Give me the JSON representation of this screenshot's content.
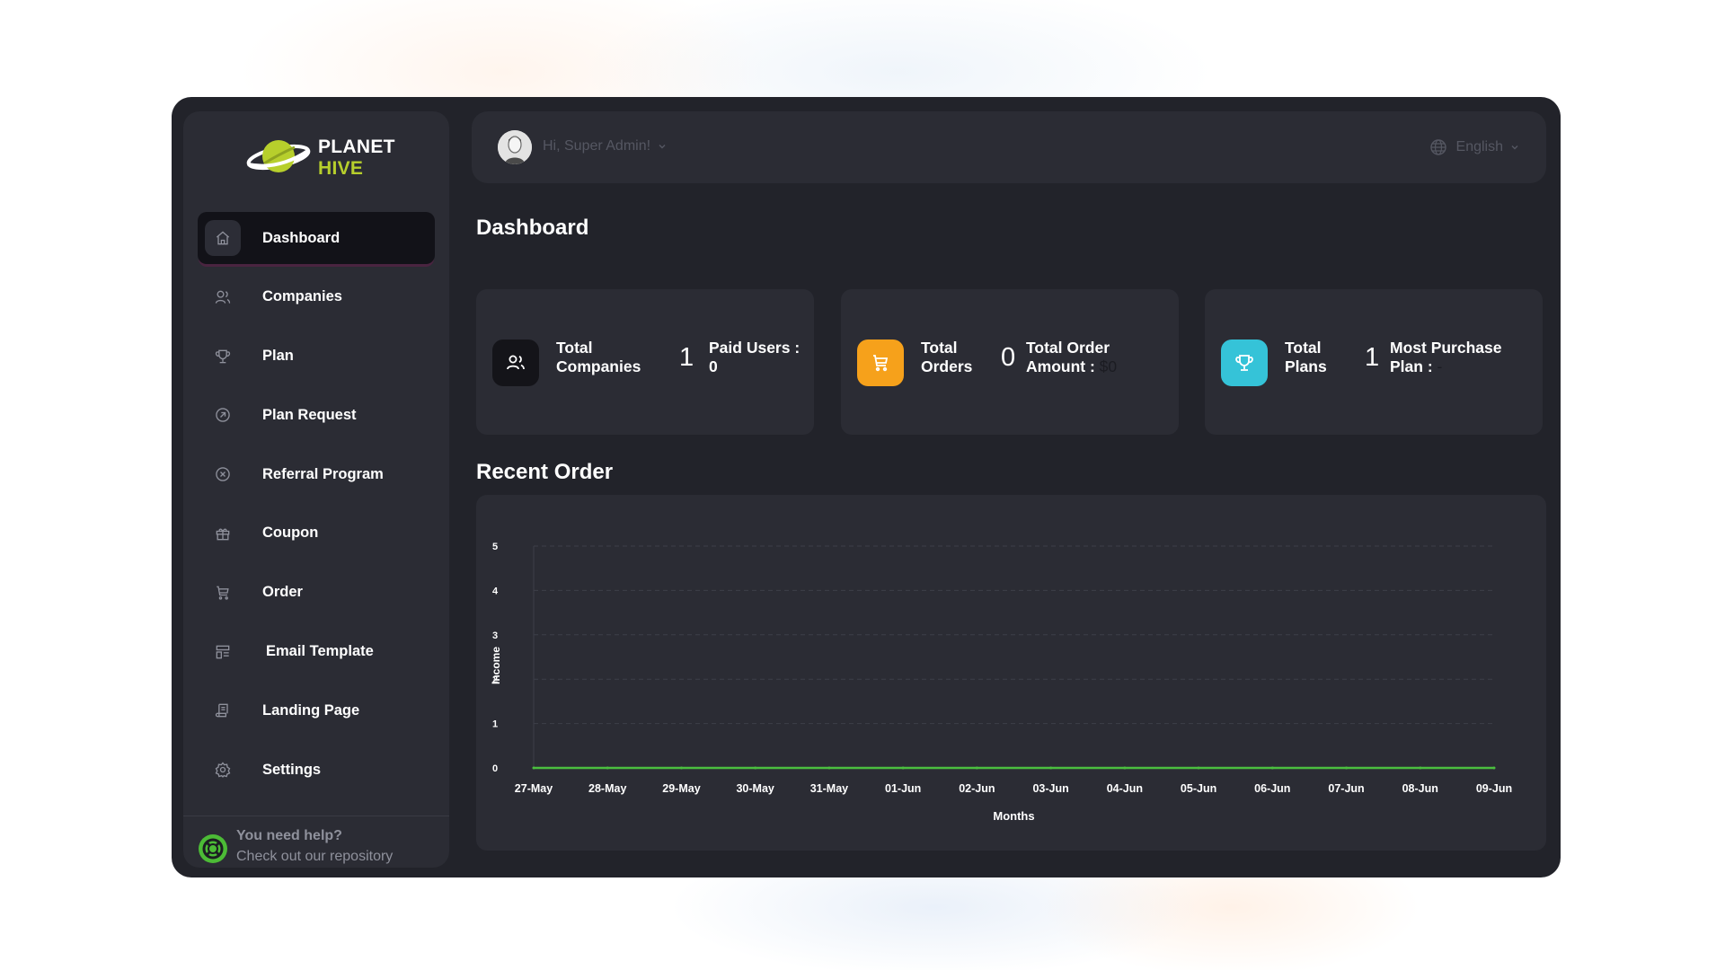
{
  "brand": {
    "line1": "PLANET",
    "line2": "HIVE"
  },
  "sidebar": {
    "items": [
      {
        "label": "Dashboard",
        "icon": "home-icon",
        "active": true
      },
      {
        "label": "Companies",
        "icon": "users-icon"
      },
      {
        "label": "Plan",
        "icon": "trophy-icon"
      },
      {
        "label": "Plan Request",
        "icon": "arrow-circle-icon"
      },
      {
        "label": "Referral Program",
        "icon": "discount-icon"
      },
      {
        "label": "Coupon",
        "icon": "gift-icon"
      },
      {
        "label": "Order",
        "icon": "cart-icon"
      },
      {
        "label": "Email Template",
        "icon": "template-icon"
      },
      {
        "label": "Landing Page",
        "icon": "file-invoice-icon"
      },
      {
        "label": "Settings",
        "icon": "gear-icon"
      }
    ],
    "help": {
      "title": "You need help?",
      "subtitle": "Check out our repository"
    }
  },
  "header": {
    "greeting": "Hi, Super Admin!",
    "language": "English"
  },
  "page": {
    "title": "Dashboard",
    "recent_order_title": "Recent Order"
  },
  "stats": [
    {
      "label": "Total Companies",
      "value": "1",
      "sub_label": "Paid Users :",
      "sub_value": "0",
      "icon": "users-icon",
      "color": "#141419"
    },
    {
      "label": "Total Orders",
      "value": "0",
      "sub_label": "Total Order Amount :",
      "sub_value": "$0",
      "icon": "cart-icon",
      "color": "#f6a11b"
    },
    {
      "label": "Total Plans",
      "value": "1",
      "sub_label": "Most Purchase Plan :",
      "sub_value": "-",
      "icon": "trophy-icon",
      "color": "#35c3d8"
    }
  ],
  "colors": {
    "accent_green": "#b7cf2c",
    "line_green": "#4bbf3f",
    "help_green": "#4cbb36"
  },
  "chart_data": {
    "type": "line",
    "title": "",
    "xlabel": "Months",
    "ylabel": "Income",
    "categories": [
      "27-May",
      "28-May",
      "29-May",
      "30-May",
      "31-May",
      "01-Jun",
      "02-Jun",
      "03-Jun",
      "04-Jun",
      "05-Jun",
      "06-Jun",
      "07-Jun",
      "08-Jun",
      "09-Jun"
    ],
    "y_ticks": [
      "0",
      "1",
      "2",
      "3",
      "4",
      "5"
    ],
    "ylim": [
      0,
      5
    ],
    "series": [
      {
        "values": [
          0,
          0,
          0,
          0,
          0,
          0,
          0,
          0,
          0,
          0,
          0,
          0,
          0,
          0
        ],
        "color": "#4bbf3f"
      }
    ],
    "grid": "horizontal dashed"
  }
}
